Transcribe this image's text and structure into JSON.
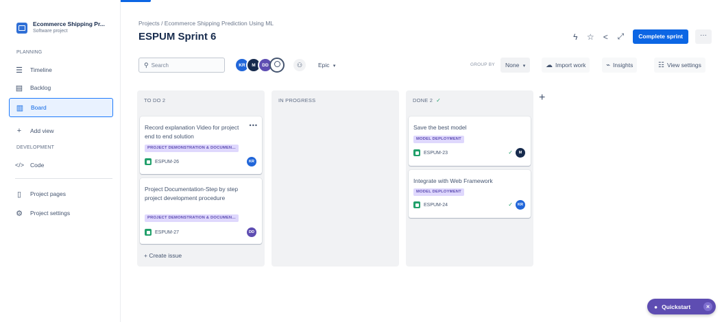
{
  "sidebar": {
    "project_name": "Ecommerce Shipping Pr...",
    "project_type": "Software project",
    "planning_label": "PLANNING",
    "development_label": "DEVELOPMENT",
    "items": [
      {
        "label": "Timeline",
        "icon": "timeline-icon"
      },
      {
        "label": "Backlog",
        "icon": "backlog-icon"
      },
      {
        "label": "Board",
        "icon": "board-icon",
        "active": true
      },
      {
        "label": "Add view",
        "icon": "plus-icon"
      },
      {
        "label": "Code",
        "icon": "code-icon"
      },
      {
        "label": "Project pages",
        "icon": "pages-icon"
      },
      {
        "label": "Project settings",
        "icon": "settings-icon"
      }
    ]
  },
  "header": {
    "breadcrumb": "Projects  /  Ecommerce Shipping Prediction Using ML",
    "title": "ESPUM Sprint 6",
    "complete_sprint": "Complete sprint",
    "more": "···"
  },
  "toolbar": {
    "search_placeholder": "Search",
    "avatars": [
      "KR",
      "M",
      "DD"
    ],
    "epic_label": "Epic",
    "group_by_label": "GROUP BY",
    "group_by_value": "None",
    "import_work": "Import work",
    "insights": "Insights",
    "view_settings": "View settings"
  },
  "columns": [
    {
      "title": "TO DO 2",
      "cards": [
        {
          "title": "Record explanation Video for project end to end solution",
          "epic": "PROJECT DEMONSTRATION & DOCUMEN...",
          "key": "ESPUM-26",
          "assignee": "KR"
        },
        {
          "title": "Project Documentation-Step by step project development procedure",
          "epic": "PROJECT DEMONSTRATION & DOCUMEN...",
          "key": "ESPUM-27",
          "assignee": "DD"
        }
      ],
      "create_issue": "+ Create issue"
    },
    {
      "title": "IN PROGRESS",
      "cards": []
    },
    {
      "title": "DONE 2",
      "done_check": "✓",
      "cards": [
        {
          "title": "Save the best model",
          "epic": "MODEL DEPLOYMENT",
          "key": "ESPUM-23",
          "assignee": "M"
        },
        {
          "title": "Integrate with Web Framework",
          "epic": "MODEL DEPLOYMENT",
          "key": "ESPUM-24",
          "assignee": "KR"
        }
      ]
    }
  ],
  "quickstart": "Quickstart",
  "colors": {
    "primary": "#0c66e4",
    "epic_bg": "#dfd8fd",
    "epic_text": "#5e4db2",
    "done": "#22a06b"
  }
}
